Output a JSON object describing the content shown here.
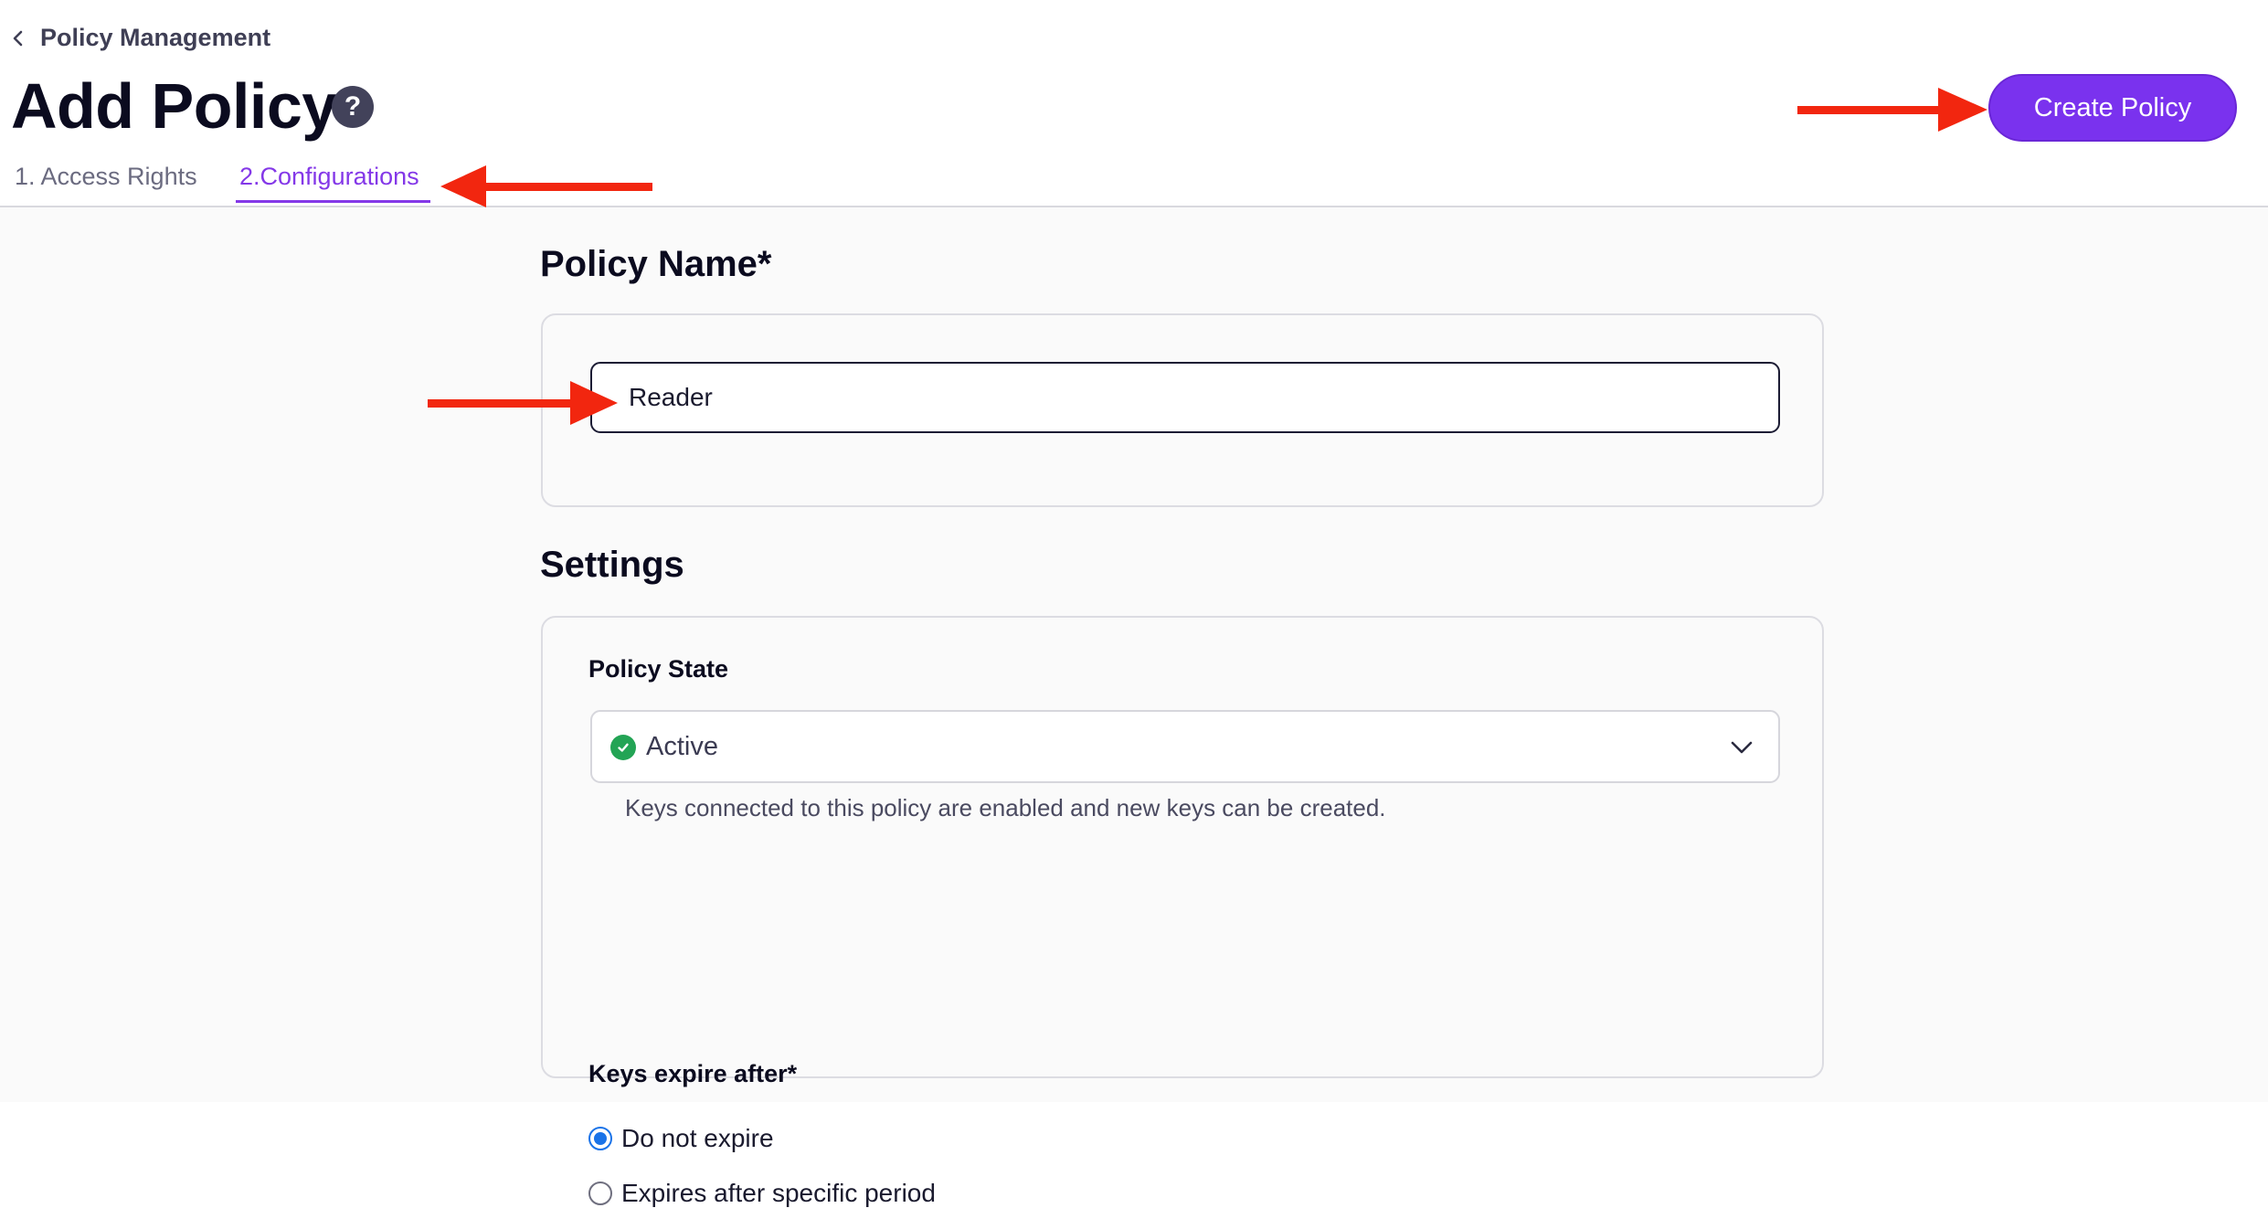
{
  "header": {
    "breadcrumb": "Policy Management",
    "title": "Add Policy",
    "help_icon_glyph": "?",
    "create_button": "Create Policy",
    "tabs": [
      {
        "label": "1. Access Rights",
        "active": false
      },
      {
        "label": "2.Configurations",
        "active": true
      }
    ]
  },
  "policy_name": {
    "heading": "Policy Name*",
    "value": "Reader"
  },
  "settings": {
    "heading": "Settings",
    "policy_state": {
      "label": "Policy State",
      "selected": "Active",
      "status_icon": "check-circle-icon",
      "helper": "Keys connected to this policy are enabled and new keys can be created."
    },
    "keys_expire": {
      "label": "Keys expire after*",
      "options": [
        {
          "label": "Do not expire",
          "checked": true
        },
        {
          "label": "Expires after specific period",
          "checked": false
        }
      ]
    }
  },
  "annotations": {
    "arrow_color": "#f2260f",
    "arrows": [
      "pointing-create-button",
      "pointing-configurations-tab",
      "pointing-policy-name-input"
    ]
  },
  "colors": {
    "accent": "#7a32ee",
    "active_tab": "#8438e8",
    "status_active": "#23a455",
    "radio_selected": "#1a73e8"
  }
}
